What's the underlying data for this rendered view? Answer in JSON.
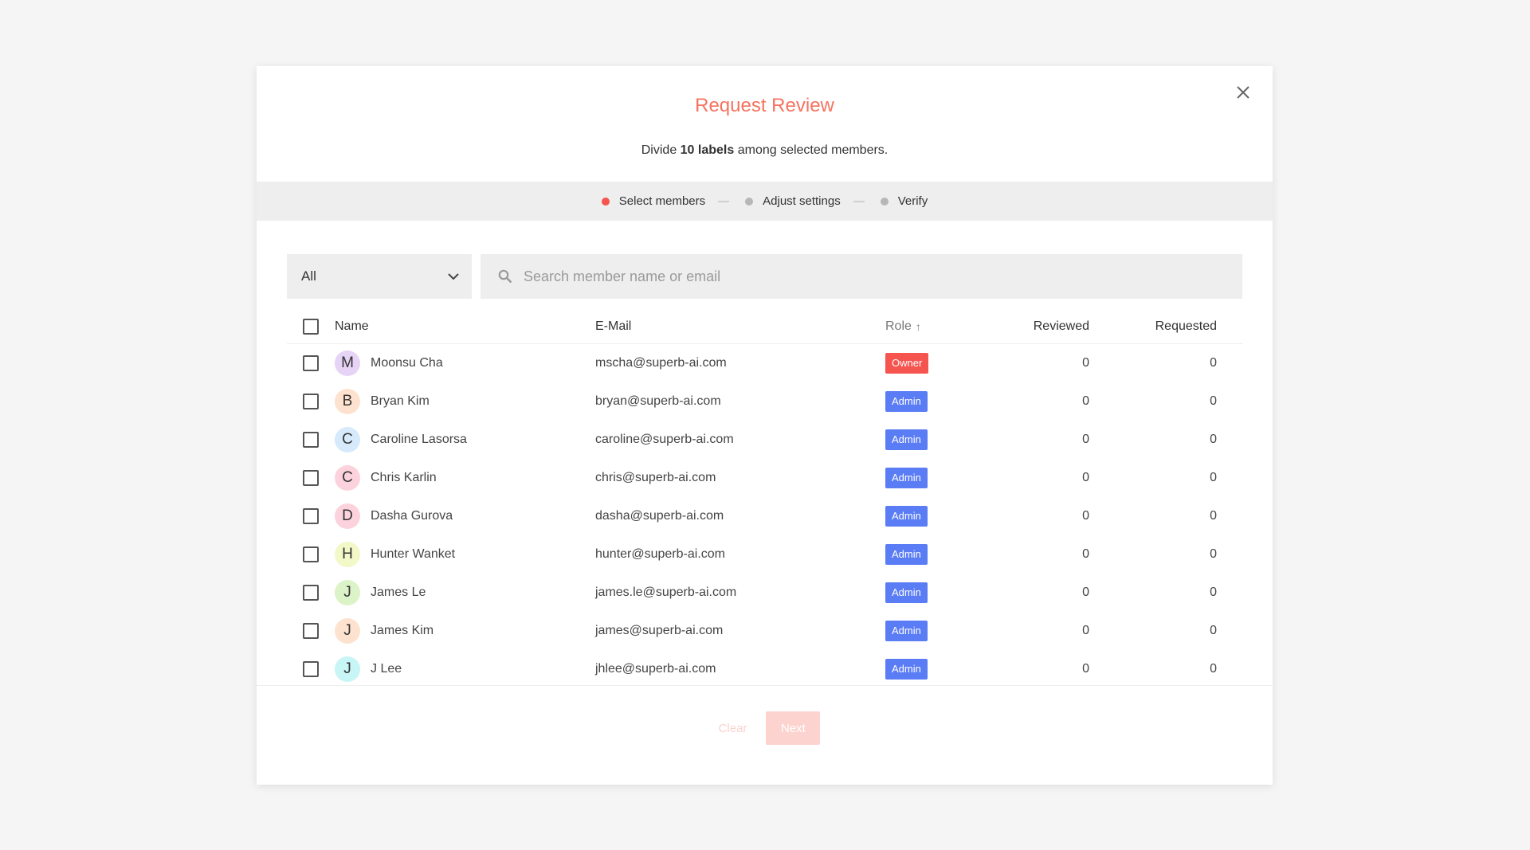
{
  "dialog": {
    "title": "Request Review",
    "subtitle_prefix": "Divide ",
    "subtitle_bold": "10 labels",
    "subtitle_suffix": " among selected members."
  },
  "steps": [
    {
      "label": "Select members",
      "active": true
    },
    {
      "label": "Adjust settings",
      "active": false
    },
    {
      "label": "Verify",
      "active": false
    }
  ],
  "filter": {
    "selected": "All"
  },
  "search": {
    "placeholder": "Search member name or email",
    "value": ""
  },
  "table": {
    "headers": {
      "name": "Name",
      "email": "E-Mail",
      "role": "Role",
      "role_sort": "↑",
      "reviewed": "Reviewed",
      "requested": "Requested"
    },
    "rows": [
      {
        "initial": "M",
        "avatar_color": "#e6d3f5",
        "name": "Moonsu Cha",
        "email": "mscha@superb-ai.com",
        "role": "Owner",
        "role_color": "#f5544f",
        "reviewed": "0",
        "requested": "0"
      },
      {
        "initial": "B",
        "avatar_color": "#fde3cf",
        "name": "Bryan Kim",
        "email": "bryan@superb-ai.com",
        "role": "Admin",
        "role_color": "#5a7cf5",
        "reviewed": "0",
        "requested": "0"
      },
      {
        "initial": "C",
        "avatar_color": "#d6eafc",
        "name": "Caroline Lasorsa",
        "email": "caroline@superb-ai.com",
        "role": "Admin",
        "role_color": "#5a7cf5",
        "reviewed": "0",
        "requested": "0"
      },
      {
        "initial": "C",
        "avatar_color": "#fcd3dc",
        "name": "Chris Karlin",
        "email": "chris@superb-ai.com",
        "role": "Admin",
        "role_color": "#5a7cf5",
        "reviewed": "0",
        "requested": "0"
      },
      {
        "initial": "D",
        "avatar_color": "#fcd3dc",
        "name": "Dasha Gurova",
        "email": "dasha@superb-ai.com",
        "role": "Admin",
        "role_color": "#5a7cf5",
        "reviewed": "0",
        "requested": "0"
      },
      {
        "initial": "H",
        "avatar_color": "#f3f8c8",
        "name": "Hunter Wanket",
        "email": "hunter@superb-ai.com",
        "role": "Admin",
        "role_color": "#5a7cf5",
        "reviewed": "0",
        "requested": "0"
      },
      {
        "initial": "J",
        "avatar_color": "#dcf3c8",
        "name": "James Le",
        "email": "james.le@superb-ai.com",
        "role": "Admin",
        "role_color": "#5a7cf5",
        "reviewed": "0",
        "requested": "0"
      },
      {
        "initial": "J",
        "avatar_color": "#fde3cf",
        "name": "James Kim",
        "email": "james@superb-ai.com",
        "role": "Admin",
        "role_color": "#5a7cf5",
        "reviewed": "0",
        "requested": "0"
      },
      {
        "initial": "J",
        "avatar_color": "#c8f5f5",
        "name": "J Lee",
        "email": "jhlee@superb-ai.com",
        "role": "Admin",
        "role_color": "#5a7cf5",
        "reviewed": "0",
        "requested": "0"
      }
    ]
  },
  "footer": {
    "clear_label": "Clear",
    "next_label": "Next"
  },
  "icons": {
    "close": "close-icon",
    "dropdown": "chevron-down-icon",
    "search": "search-icon",
    "sort": "arrow-up-icon"
  },
  "colors": {
    "accent": "#f5735f",
    "owner_badge": "#f5544f",
    "admin_badge": "#5a7cf5",
    "active_step": "#f5544f"
  }
}
